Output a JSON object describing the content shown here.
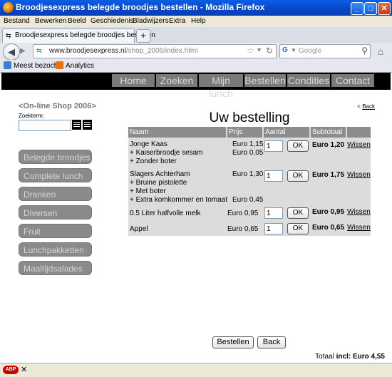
{
  "window": {
    "title": "Broodjesexpress belegde broodjes bestellen - Mozilla Firefox",
    "minimize": "_",
    "maximize": "□",
    "close": "✕"
  },
  "menu": [
    "Bestand",
    "Bewerken",
    "Beeld",
    "Geschiedenis",
    "Bladwijzers",
    "Extra",
    "Help"
  ],
  "tab": {
    "label": "Broodjesexpress belegde broodjes bestellen",
    "new_tab": "+"
  },
  "nav": {
    "url_domain": "www.broodjesexpress.nl",
    "url_path": "/shop_2006/index.html",
    "search_placeholder": "Google"
  },
  "bookmarks": [
    "Meest bezocht",
    "Analytics"
  ],
  "site": {
    "topnav": [
      "Home",
      "Zoeken",
      "Mijn lunch",
      "Bestellen",
      "Condities",
      "Contact"
    ],
    "shop_name": "<On-line Shop 2006>",
    "search_label": "Zoekterm:",
    "back_link_prefix": "< ",
    "back_link": "Back",
    "categories": [
      "Belegde broodjes",
      "Complete lunch",
      "Dranken",
      "Diversen",
      "Fruit",
      "Lunchpakketten",
      "Maaltijdsalades"
    ],
    "heading": "Uw bestelling",
    "table_headers": [
      "Naam",
      "Prijs",
      "Aantal",
      "Subtotaal"
    ],
    "items": [
      {
        "lines": [
          "Jonge Kaas",
          "+ Kaiserbroodje sesam",
          "+ Zonder boter"
        ],
        "prices": [
          "Euro 1,15",
          "Euro 0,05",
          ""
        ],
        "qty": "1",
        "ok": "OK",
        "subtotal": "Euro 1,20",
        "remove": "Wissen"
      },
      {
        "lines": [
          "Slagers Achterham",
          "+ Bruine pistolette",
          "+ Met boter",
          "+ Extra komkommer en tomaat"
        ],
        "prices": [
          "Euro 1,30",
          "",
          "",
          "Euro 0,45"
        ],
        "qty": "1",
        "ok": "OK",
        "subtotal": "Euro 1,75",
        "remove": "Wissen"
      },
      {
        "lines": [
          "0.5 Liter halfvolle melk"
        ],
        "prices": [
          "Euro 0,95"
        ],
        "qty": "1",
        "ok": "OK",
        "subtotal": "Euro 0,95",
        "remove": "Wissen"
      },
      {
        "lines": [
          "Appel"
        ],
        "prices": [
          "Euro 0,65"
        ],
        "qty": "1",
        "ok": "OK",
        "subtotal": "Euro 0,65",
        "remove": "Wissen"
      }
    ],
    "buttons": {
      "order": "Bestellen",
      "back": "Back"
    },
    "total_label": "Totaal ",
    "total_bold": "incl:",
    "total_value": " Euro 4,55"
  },
  "statusbar": {
    "adblock": "ABP",
    "close": "✕"
  },
  "colors": {
    "titlebar": "#0646c8",
    "nav_button": "#7a7a7a",
    "category_button": "#8a8a8a",
    "table_header": "#8c8c8c",
    "table_body": "#dcdcdc"
  }
}
